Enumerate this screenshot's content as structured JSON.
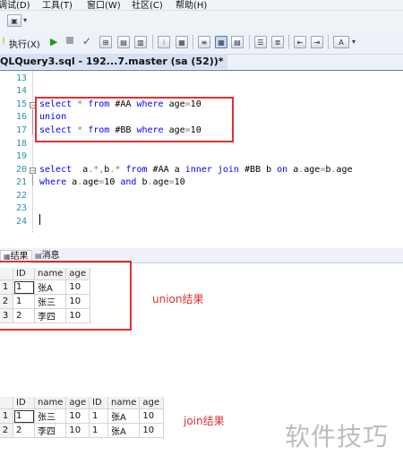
{
  "menubar": {
    "items": [
      "调试(D)",
      "工具(T)",
      "窗口(W)",
      "社区(C)",
      "帮助(H)"
    ]
  },
  "toolbar": {
    "execute_label": "执行(X)",
    "format_label": "A",
    "dropdown_label": "▾"
  },
  "tab": {
    "title": "QLQuery3.sql - 192...7.master (sa (52))*"
  },
  "editor": {
    "line_numbers": [
      "13",
      "14",
      "15",
      "16",
      "17",
      "18",
      "19",
      "20",
      "21",
      "22",
      "23",
      "24"
    ],
    "lines": [
      "",
      "",
      "select * from #AA where age=10",
      "union",
      "select * from #BB where age=10",
      "",
      "",
      "select  a.*,b.* from #AA a inner join #BB b on a.age=b.age",
      "where a.age=10 and b.age=10",
      "",
      "",
      ""
    ]
  },
  "results": {
    "tabs": [
      "结果",
      "消息"
    ],
    "union_table": {
      "headers": [
        "ID",
        "name",
        "age"
      ],
      "rows": [
        {
          "rn": "1",
          "cells": [
            "1",
            "张A",
            "10"
          ]
        },
        {
          "rn": "2",
          "cells": [
            "1",
            "张三",
            "10"
          ]
        },
        {
          "rn": "3",
          "cells": [
            "2",
            "李四",
            "10"
          ]
        }
      ]
    },
    "join_table": {
      "headers": [
        "ID",
        "name",
        "age",
        "ID",
        "name",
        "age"
      ],
      "rows": [
        {
          "rn": "1",
          "cells": [
            "1",
            "张三",
            "10",
            "1",
            "张A",
            "10"
          ]
        },
        {
          "rn": "2",
          "cells": [
            "2",
            "李四",
            "10",
            "1",
            "张A",
            "10"
          ]
        }
      ]
    },
    "union_annotation": "union结果",
    "join_annotation": "join结果"
  },
  "watermark": "软件技巧",
  "colors": {
    "highlight_red": "#e03131",
    "keyword_blue": "#0000ff",
    "line_number_teal": "#2b91af"
  }
}
